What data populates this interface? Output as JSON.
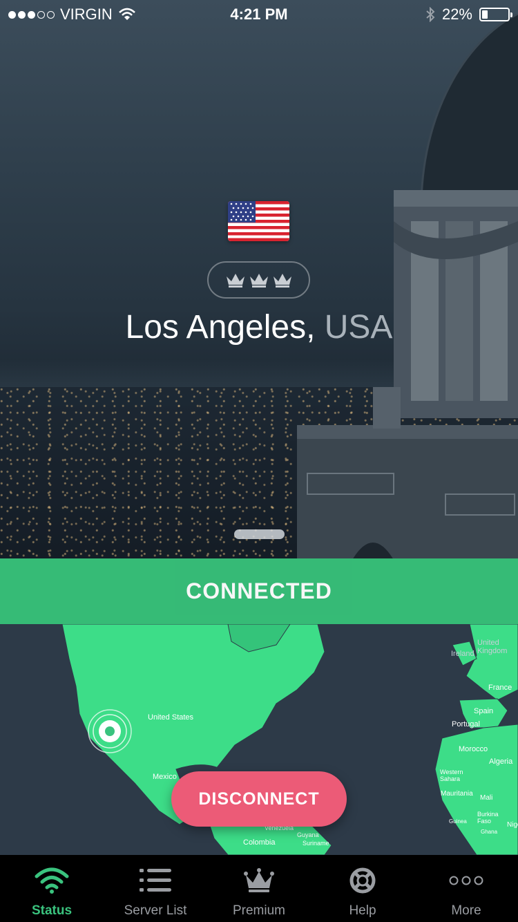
{
  "status_bar": {
    "carrier": "VIRGIN",
    "signal_bars_filled": 3,
    "signal_bars_total": 5,
    "time": "4:21 PM",
    "battery_text": "22%",
    "battery_level": 0.22
  },
  "location": {
    "city": "Los Angeles,",
    "country": "USA",
    "flag_icon": "us-flag-icon",
    "tier_icon": "crown-icon",
    "tier_count": 3
  },
  "connection": {
    "status": "CONNECTED",
    "status_color": "#38c17a",
    "disconnect_label": "DISCONNECT",
    "disconnect_color": "#ec5b77"
  },
  "map": {
    "labels": [
      "United States",
      "Mexico",
      "Venezuela",
      "Colombia",
      "Guyana",
      "Suriname",
      "Ireland",
      "United Kingdom",
      "France",
      "Spain",
      "Portugal",
      "Morocco",
      "Algeria",
      "Western Sahara",
      "Mauritania",
      "Mali",
      "Burkina Faso",
      "Guinea",
      "Ghana",
      "Niger"
    ]
  },
  "tabs": [
    {
      "label": "Status",
      "icon": "wifi-icon",
      "active": true
    },
    {
      "label": "Server List",
      "icon": "list-icon",
      "active": false
    },
    {
      "label": "Premium",
      "icon": "crown-icon",
      "active": false
    },
    {
      "label": "Help",
      "icon": "lifebuoy-icon",
      "active": false
    },
    {
      "label": "More",
      "icon": "more-icon",
      "active": false
    }
  ]
}
